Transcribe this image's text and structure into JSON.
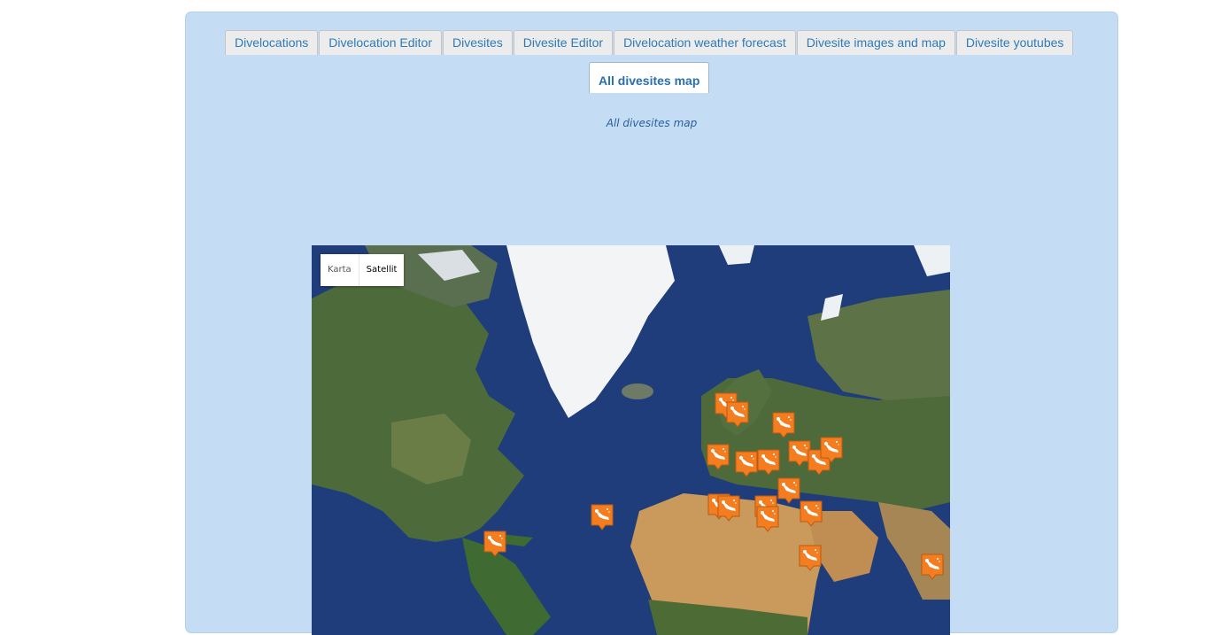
{
  "tabs": [
    {
      "label": "Divelocations"
    },
    {
      "label": "Divelocation Editor"
    },
    {
      "label": "Divesites"
    },
    {
      "label": "Divesite Editor"
    },
    {
      "label": "Divelocation weather forecast"
    },
    {
      "label": "Divesite images and map"
    },
    {
      "label": "Divesite youtubes"
    }
  ],
  "active_tab": {
    "label": "All divesites map"
  },
  "caption": "All divesites map",
  "map": {
    "type_control": {
      "map_label": "Karta",
      "satellite_label": "Satellit",
      "selected": "Satellit"
    },
    "marker_icon": "diver-icon",
    "marker_color": "#f47d20"
  },
  "colors": {
    "panel_bg": "#c4ddf5",
    "tab_text": "#2f7ab8",
    "ocean": "#1f3d7a",
    "land": "#4d6b3a",
    "desert": "#c99a5b",
    "ice": "#f2f4f6"
  }
}
